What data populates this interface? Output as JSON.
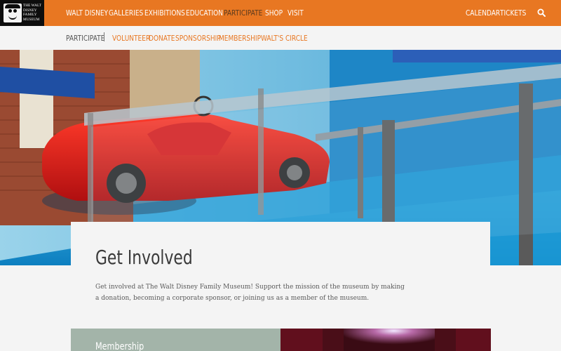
{
  "brand": {
    "logo_text": "THE WALT DISNEY FAMILY MUSEUM"
  },
  "topnav": {
    "items": [
      {
        "label": "WALT DISNEY"
      },
      {
        "label": "GALLERIES"
      },
      {
        "label": "EXHIBITIONS"
      },
      {
        "label": "EDUCATION"
      },
      {
        "label": "PARTICIPATE"
      },
      {
        "label": "SHOP"
      },
      {
        "label": "VISIT"
      }
    ],
    "right_items": [
      {
        "label": "CALENDAR"
      },
      {
        "label": "TICKETS"
      }
    ],
    "search_icon": "search-icon"
  },
  "subnav": {
    "current": "PARTICIPATE",
    "items": [
      {
        "label": "VOLUNTEER"
      },
      {
        "label": "DONATE"
      },
      {
        "label": "SPONSORSHIP"
      },
      {
        "label": "MEMBERSHIP"
      },
      {
        "label": "WALT'S CIRCLE"
      }
    ]
  },
  "main": {
    "title": "Get Involved",
    "intro": "Get involved at The Walt Disney Family Museum! Support the mission of the museum by making a donation, becoming a corporate sponsor, or joining us as a member of the museum."
  },
  "tiles": [
    {
      "label": "Membership"
    }
  ],
  "colors": {
    "accent": "#e87722",
    "active_nav": "#5a3a1e",
    "tile_green": "#a3b4a9"
  }
}
